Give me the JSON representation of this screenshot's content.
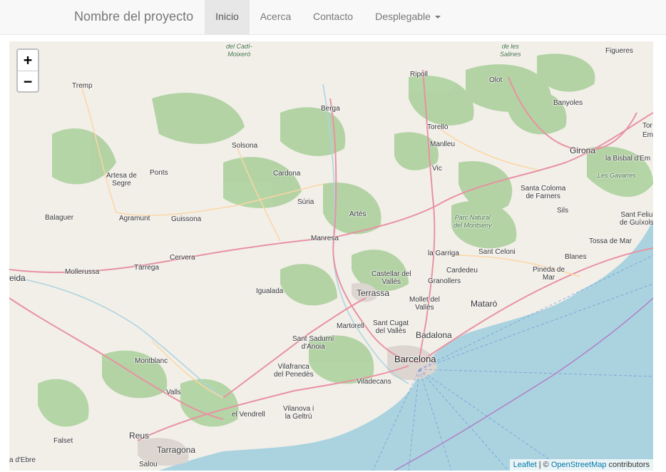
{
  "navbar": {
    "brand": "Nombre del proyecto",
    "items": [
      {
        "label": "Inicio",
        "active": true
      },
      {
        "label": "Acerca",
        "active": false
      },
      {
        "label": "Contacto",
        "active": false
      },
      {
        "label": "Desplegable",
        "active": false,
        "dropdown": true
      }
    ]
  },
  "map": {
    "zoom_in": "+",
    "zoom_out": "−",
    "attribution": {
      "leaflet": "Leaflet",
      "separator": " | © ",
      "osm": "OpenStreetMap",
      "suffix": " contributors"
    },
    "places": {
      "cadi": "del Cadí-\nMoixeró",
      "salines": "de les\nSalines",
      "figueres": "Figueres",
      "tremp": "Tremp",
      "ripoll": "Ripoll",
      "olot": "Olot",
      "berga": "Berga",
      "banyoles": "Banyoles",
      "torello": "Torelló",
      "tor": "Tor",
      "em": "Em",
      "solsona": "Solsona",
      "manlleu": "Manlleu",
      "girona": "Girona",
      "bisbal": "la Bisbal d'Em",
      "gavarres": "Les Gavarres",
      "artesa": "Artesa de\nSegre",
      "ponts": "Ponts",
      "cardona": "Cardona",
      "vic": "Vic",
      "santa_coloma": "Santa Coloma\nde Farners",
      "suria": "Súria",
      "sils": "Sils",
      "balaguer": "Balaguer",
      "agramunt": "Agramunt",
      "guissona": "Guissona",
      "artes": "Artés",
      "montseny": "Parc Natural\ndel Montseny",
      "sant_feliu": "Sant Feliu\nde Guíxols",
      "manresa": "Manresa",
      "tossa": "Tossa de Mar",
      "cervera": "Cervera",
      "garriga": "la Garriga",
      "sant_celoni": "Sant Celoni",
      "blanes": "Blanes",
      "mollerussa": "Mollerussa",
      "tarrega": "Tàrrega",
      "cardedeu": "Cardedeu",
      "pineda": "Pineda de\nMar",
      "lleida": "eida",
      "castellar": "Castellar del\nVallès",
      "granollers": "Granollers",
      "igualada": "Igualada",
      "terrassa": "Terrassa",
      "mollet": "Mollet del\nVallès",
      "mataro": "Mataró",
      "martorell": "Martorell",
      "sant_cugat": "Sant Cugat\ndel Vallès",
      "badalona": "Badalona",
      "sant_sadurni": "Sant Sadurní\nd'Anoia",
      "barcelona": "Barcelona",
      "montblanc": "Montblanc",
      "vilafranca": "Vilafranca\ndel Penedès",
      "viladecans": "Viladecans",
      "valls": "Valls",
      "vendrell": "el Vendrell",
      "vilanova": "Vilanova i\nla Geltrú",
      "falset": "Falset",
      "reus": "Reus",
      "tarragona": "Tarragona",
      "ebre": "a d'Ebre",
      "salou": "Salou"
    }
  }
}
